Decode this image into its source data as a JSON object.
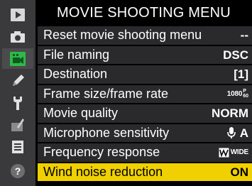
{
  "title": "MOVIE SHOOTING MENU",
  "sidebar": {
    "icons": [
      "playback-icon",
      "camera-icon",
      "movie-icon",
      "pencil-icon",
      "wrench-icon",
      "retouch-icon",
      "my-menu-icon",
      "help-icon"
    ],
    "active": "movie-icon"
  },
  "menu": {
    "items": [
      {
        "label": "Reset movie shooting menu",
        "value": "--"
      },
      {
        "label": "File naming",
        "value": "DSC"
      },
      {
        "label": "Destination",
        "value": "[1]"
      },
      {
        "label": "Frame size/frame rate",
        "value_main": "1080",
        "value_top": "P",
        "value_bottom": "60"
      },
      {
        "label": "Movie quality",
        "value": "NORM"
      },
      {
        "label": "Microphone sensitivity",
        "value": "A",
        "value_icon": "microphone-icon"
      },
      {
        "label": "Frequency response",
        "value": "WIDE",
        "value_icon": "frequency-response-icon"
      },
      {
        "label": "Wind noise reduction",
        "value": "ON",
        "selected": true
      }
    ]
  },
  "colors": {
    "highlight": "#f0d000",
    "row_bg": "#2a2a2c",
    "rail_bg": "#3a3a3c",
    "movie_icon_green": "#2fb84a"
  }
}
